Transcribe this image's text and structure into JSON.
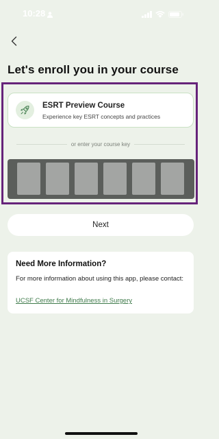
{
  "status_bar": {
    "time": "10:28"
  },
  "header": {
    "title": "Let's enroll you in your course"
  },
  "course_option": {
    "title": "ESRT Preview Course",
    "subtitle": "Experience key ESRT concepts and practices",
    "icon": "rocket-icon"
  },
  "divider_text": "or enter your course key",
  "course_key": {
    "slots": [
      "",
      "",
      "",
      "",
      "",
      ""
    ]
  },
  "next_button": {
    "label": "Next"
  },
  "info": {
    "title": "Need More Information?",
    "body": "For more information about using this app, please contact:",
    "link": "UCSF Center for Mindfulness in Surgery"
  },
  "colors": {
    "background": "#edf2ea",
    "accent": "#3e7a4a",
    "highlight": "#66237a",
    "key_panel": "#5b5e5b"
  }
}
